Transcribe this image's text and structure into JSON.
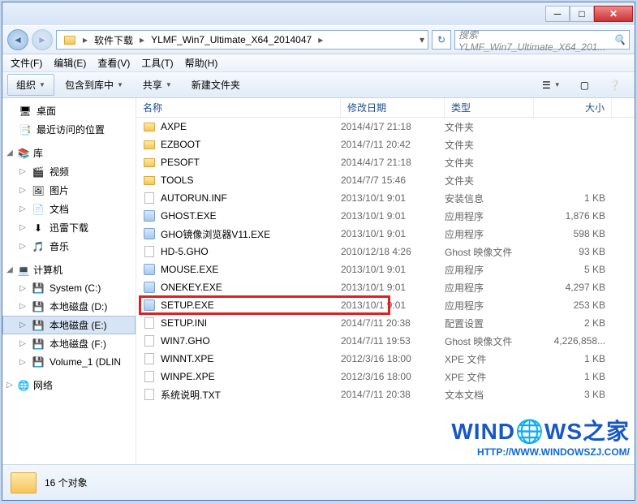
{
  "nav": {
    "seg1": "软件下载",
    "seg2": "YLMF_Win7_Ultimate_X64_2014047",
    "search_placeholder": "搜索 YLMF_Win7_Ultimate_X64_201..."
  },
  "menu": {
    "file": "文件(F)",
    "edit": "编辑(E)",
    "view": "查看(V)",
    "tools": "工具(T)",
    "help": "帮助(H)"
  },
  "toolbar": {
    "organize": "组织",
    "include": "包含到库中",
    "share": "共享",
    "newfolder": "新建文件夹"
  },
  "sidebar": {
    "quick": {
      "desktop": "桌面",
      "recent": "最近访问的位置"
    },
    "libraries": {
      "header": "库",
      "video": "视频",
      "pictures": "图片",
      "docs": "文档",
      "xunlei": "迅雷下载",
      "music": "音乐"
    },
    "computer": {
      "header": "计算机",
      "c": "System (C:)",
      "d": "本地磁盘 (D:)",
      "e": "本地磁盘 (E:)",
      "f": "本地磁盘 (F:)",
      "g": "Volume_1 (DLIN"
    },
    "network": {
      "header": "网络"
    }
  },
  "columns": {
    "name": "名称",
    "date": "修改日期",
    "type": "类型",
    "size": "大小"
  },
  "files": [
    {
      "icon": "folder",
      "name": "AXPE",
      "date": "2014/4/17 21:18",
      "type": "文件夹",
      "size": ""
    },
    {
      "icon": "folder",
      "name": "EZBOOT",
      "date": "2014/7/11 20:42",
      "type": "文件夹",
      "size": ""
    },
    {
      "icon": "folder",
      "name": "PESOFT",
      "date": "2014/4/17 21:18",
      "type": "文件夹",
      "size": ""
    },
    {
      "icon": "folder",
      "name": "TOOLS",
      "date": "2014/7/7 15:46",
      "type": "文件夹",
      "size": ""
    },
    {
      "icon": "file",
      "name": "AUTORUN.INF",
      "date": "2013/10/1 9:01",
      "type": "安装信息",
      "size": "1 KB"
    },
    {
      "icon": "exe",
      "name": "GHOST.EXE",
      "date": "2013/10/1 9:01",
      "type": "应用程序",
      "size": "1,876 KB"
    },
    {
      "icon": "exe",
      "name": "GHO镜像浏览器V11.EXE",
      "date": "2013/10/1 9:01",
      "type": "应用程序",
      "size": "598 KB"
    },
    {
      "icon": "file",
      "name": "HD-5.GHO",
      "date": "2010/12/18 4:26",
      "type": "Ghost 映像文件",
      "size": "93 KB"
    },
    {
      "icon": "exe",
      "name": "MOUSE.EXE",
      "date": "2013/10/1 9:01",
      "type": "应用程序",
      "size": "5 KB"
    },
    {
      "icon": "exe",
      "name": "ONEKEY.EXE",
      "date": "2013/10/1 9:01",
      "type": "应用程序",
      "size": "4,297 KB"
    },
    {
      "icon": "exe",
      "name": "SETUP.EXE",
      "date": "2013/10/1 9:01",
      "type": "应用程序",
      "size": "253 KB"
    },
    {
      "icon": "file",
      "name": "SETUP.INI",
      "date": "2014/7/11 20:38",
      "type": "配置设置",
      "size": "2 KB"
    },
    {
      "icon": "file",
      "name": "WIN7.GHO",
      "date": "2014/7/11 19:53",
      "type": "Ghost 映像文件",
      "size": "4,226,858..."
    },
    {
      "icon": "file",
      "name": "WINNT.XPE",
      "date": "2012/3/16 18:00",
      "type": "XPE 文件",
      "size": "1 KB"
    },
    {
      "icon": "file",
      "name": "WINPE.XPE",
      "date": "2012/3/16 18:00",
      "type": "XPE 文件",
      "size": "1 KB"
    },
    {
      "icon": "file",
      "name": "系统说明.TXT",
      "date": "2014/7/11 20:38",
      "type": "文本文档",
      "size": "3 KB"
    }
  ],
  "status": {
    "count": "16 个对象"
  },
  "watermark": {
    "big": "WIND🌐WS之家",
    "small": "HTTP://WWW.WINDOWSZJ.COM/"
  }
}
